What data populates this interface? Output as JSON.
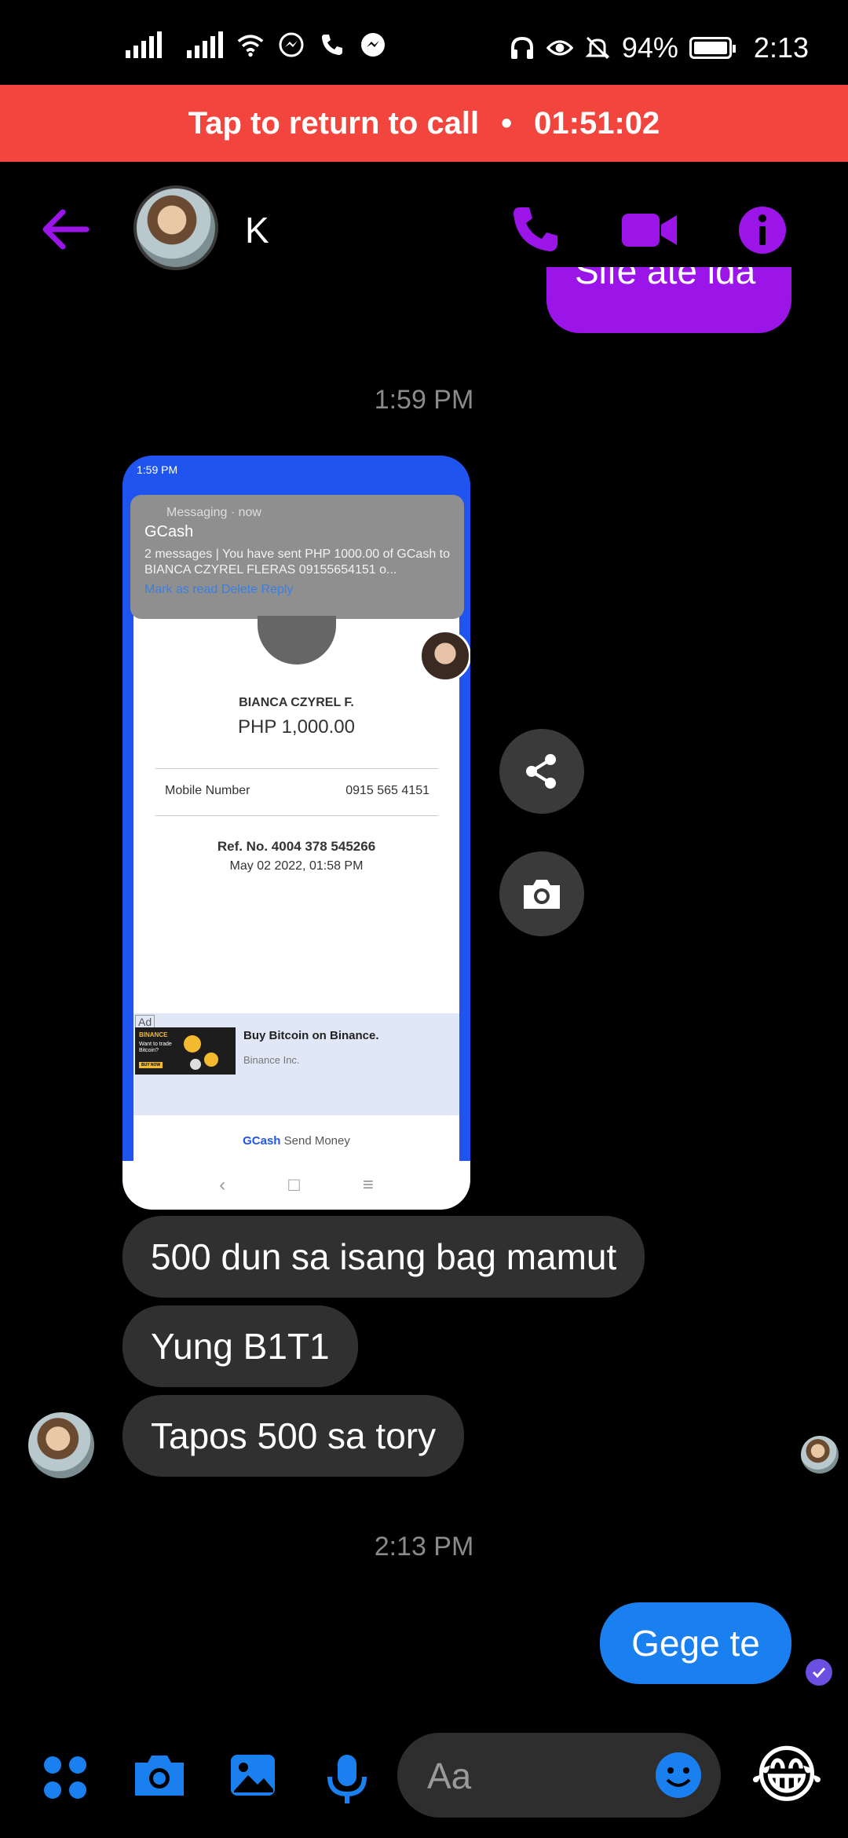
{
  "status_bar": {
    "battery": "94%",
    "time": "2:13"
  },
  "call_banner": {
    "text": "Tap to return to call",
    "separator": "•",
    "duration": "01:51:02"
  },
  "header": {
    "contact_name": "K"
  },
  "messages": {
    "previous_outgoing_partial": "Sife ate ida",
    "timestamp_1": "1:59 PM",
    "screenshot": {
      "status_time": "1:59 PM",
      "notif_app": "Messaging · now",
      "notif_title": "GCash",
      "notif_body": "2 messages | You have sent PHP 1000.00 of GCash to BIANCA CZYREL FLERAS 09155654151 o...",
      "notif_actions": "Mark as read  Delete  Reply",
      "recipient": "BIANCA CZYREL F.",
      "amount": "PHP 1,000.00",
      "mobile_label": "Mobile Number",
      "mobile_value": "0915 565 4151",
      "ref": "Ref. No. 4004 378 545266",
      "date": "May 02 2022, 01:58 PM",
      "ad_tag": "Ad",
      "ad_title": "Buy Bitcoin on Binance.",
      "ad_sub": "Binance Inc.",
      "ad_img_brand": "BINANCE",
      "ad_img_text": "Want to trade Bitcoin?",
      "ad_img_btn": "BUY NOW",
      "footer_brand": "GCash",
      "footer_text": "Send Money"
    },
    "incoming": [
      "500 dun sa isang bag mamut",
      "Yung B1T1",
      "Tapos 500 sa tory"
    ],
    "timestamp_2": "2:13 PM",
    "outgoing": "Gege te"
  },
  "composer": {
    "placeholder": "Aa",
    "reaction_emoji": "😂"
  },
  "colors": {
    "accent_purple": "#9b14e8",
    "call_red": "#f2453d",
    "outgoing_blue": "#1a80f0",
    "incoming_gray": "#303030"
  }
}
